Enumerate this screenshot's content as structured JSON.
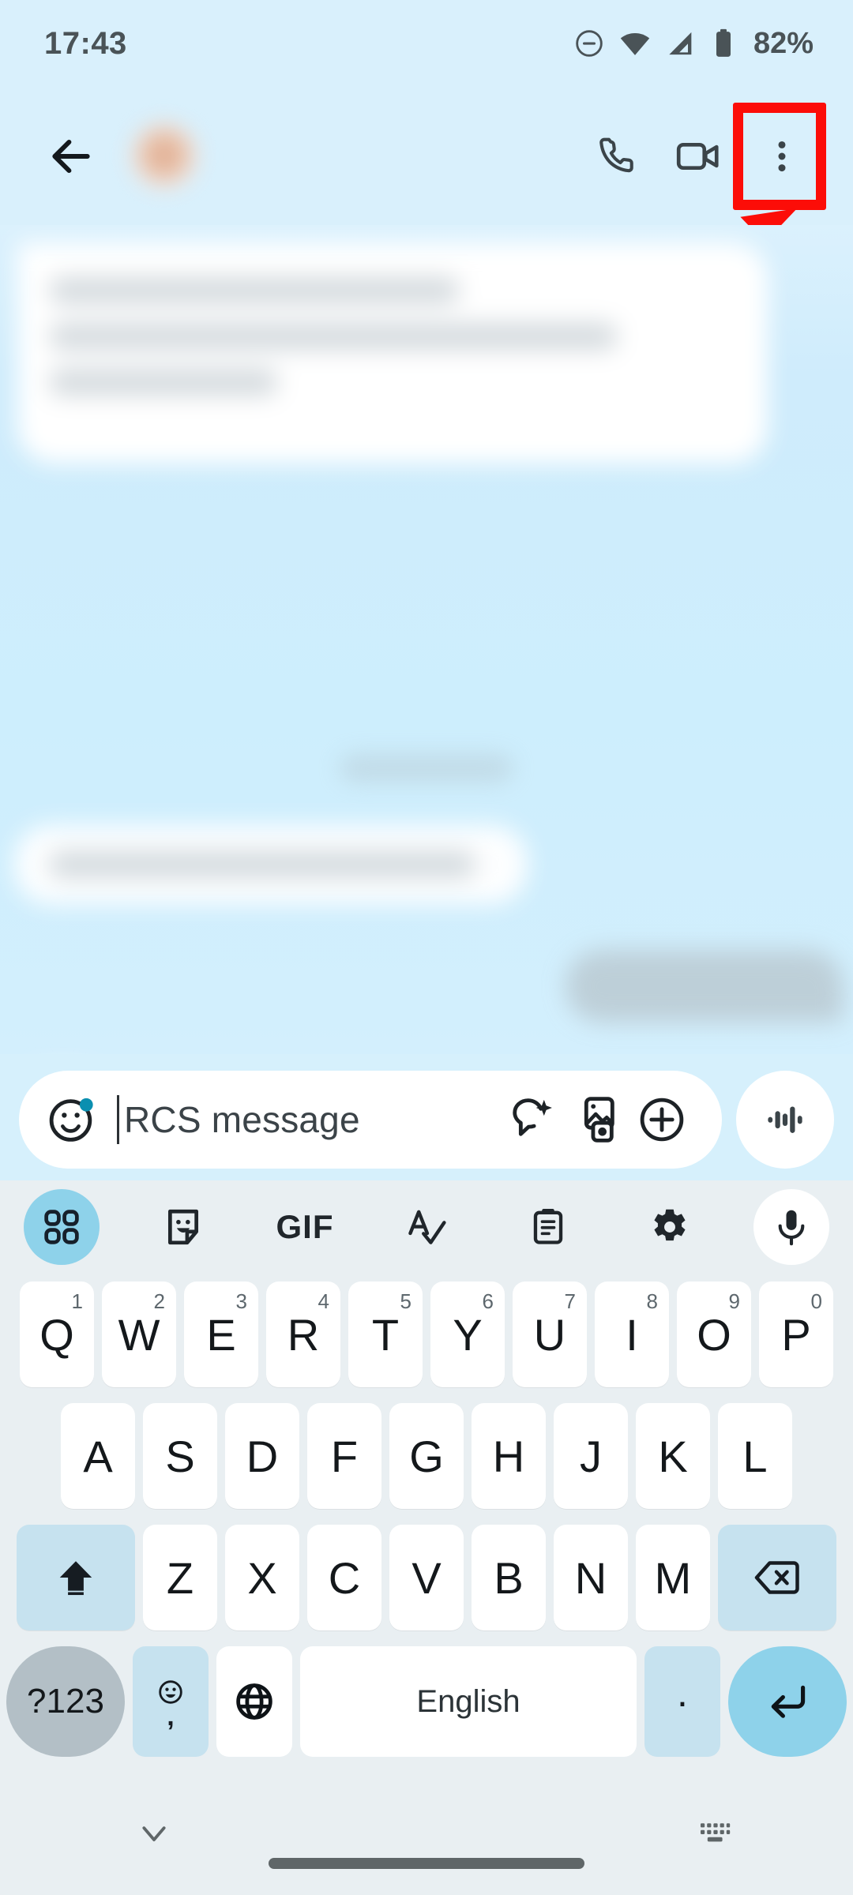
{
  "status_bar": {
    "time": "17:43",
    "battery_percent": "82%",
    "icons": [
      "dnd-icon",
      "wifi-icon",
      "cellular-signal-icon",
      "battery-icon"
    ]
  },
  "app_bar": {
    "back_label": "Back",
    "contact_name": "       ",
    "avatar_label": "Contact avatar",
    "call_label": "Call",
    "video_call_label": "Video call",
    "overflow_label": "More options",
    "highlight_color": "#fc0d08"
  },
  "conversation": {
    "messages_obscured": true
  },
  "compose": {
    "placeholder": "RCS message",
    "value": "",
    "emoji_label": "Emoji",
    "magic_compose_label": "Magic Compose",
    "gallery_label": "Gallery",
    "more_label": "Add attachment",
    "voice_label": "Voice message"
  },
  "keyboard": {
    "toolbar": [
      {
        "name": "apps-grid-icon",
        "active": true
      },
      {
        "name": "sticker-icon",
        "active": false
      },
      {
        "name": "gif-icon",
        "label": "GIF",
        "active": false
      },
      {
        "name": "spellcheck-icon",
        "active": false
      },
      {
        "name": "clipboard-icon",
        "active": false
      },
      {
        "name": "settings-gear-icon",
        "active": false
      },
      {
        "name": "microphone-icon",
        "active": false
      }
    ],
    "row1": [
      {
        "letter": "Q",
        "num": "1"
      },
      {
        "letter": "W",
        "num": "2"
      },
      {
        "letter": "E",
        "num": "3"
      },
      {
        "letter": "R",
        "num": "4"
      },
      {
        "letter": "T",
        "num": "5"
      },
      {
        "letter": "Y",
        "num": "6"
      },
      {
        "letter": "U",
        "num": "7"
      },
      {
        "letter": "I",
        "num": "8"
      },
      {
        "letter": "O",
        "num": "9"
      },
      {
        "letter": "P",
        "num": "0"
      }
    ],
    "row2": [
      {
        "letter": "A"
      },
      {
        "letter": "S"
      },
      {
        "letter": "D"
      },
      {
        "letter": "F"
      },
      {
        "letter": "G"
      },
      {
        "letter": "H"
      },
      {
        "letter": "J"
      },
      {
        "letter": "K"
      },
      {
        "letter": "L"
      }
    ],
    "row3": [
      {
        "letter": "Z"
      },
      {
        "letter": "X"
      },
      {
        "letter": "C"
      },
      {
        "letter": "V"
      },
      {
        "letter": "B"
      },
      {
        "letter": "N"
      },
      {
        "letter": "M"
      }
    ],
    "shift_label": "Shift",
    "backspace_label": "Backspace",
    "symbols_label": "?123",
    "comma_label": ",",
    "globe_label": "Change language",
    "space_label": "English",
    "period_label": ".",
    "enter_label": "Enter"
  },
  "nav_bar": {
    "hide_keyboard_label": "Hide keyboard",
    "switch_keyboard_label": "Switch keyboard",
    "home_indicator_label": "Home"
  }
}
